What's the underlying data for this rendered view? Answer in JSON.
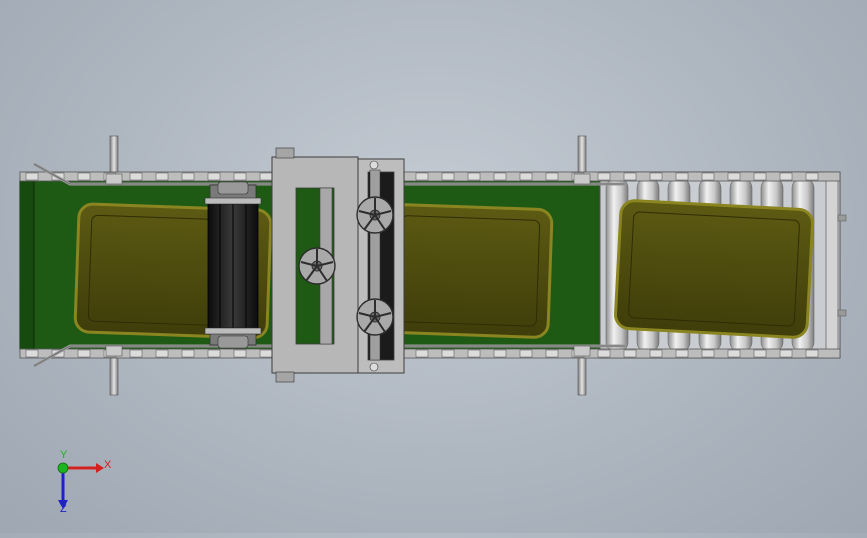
{
  "view": {
    "background_top": "#c4cbd3",
    "background_bottom": "#9ea7b2"
  },
  "colors": {
    "belt": "#1f5a14",
    "belt_dark": "#123d0b",
    "box": "#4e4c0e",
    "box_edge": "#7a7620",
    "frame": "#b8b8b8",
    "frame_dark": "#6d6d6d",
    "roller": "#d8d8d8",
    "brush": "#1c1c1c"
  },
  "triad": {
    "x_label": "X",
    "y_label": "Y",
    "z_label": "Z",
    "x_color": "#d42020",
    "y_color": "#1fb31f",
    "z_color": "#2020c8"
  }
}
